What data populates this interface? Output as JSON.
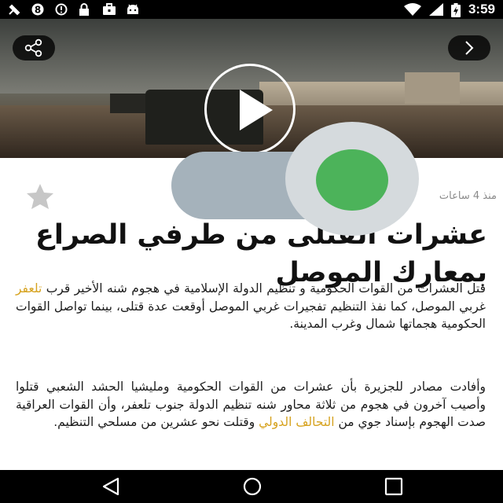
{
  "status_bar": {
    "time": "3:59",
    "icons": [
      "satellite-icon",
      "circle-8-icon",
      "block-icon",
      "lock-icon",
      "briefcase-icon",
      "android-icon",
      "wifi-icon",
      "signal-icon",
      "battery-charging-icon"
    ]
  },
  "hero": {
    "buttons": [
      "share-icon",
      "chevron-right-icon",
      "play-icon"
    ]
  },
  "article": {
    "timestamp": "منذ 4 ساعات",
    "title": "عشرات القتلى من طرفي الصراع بمعارك الموصل",
    "p1_part1": "قتل العشرات من القوات الحكومية و تنظيم الدولة الإسلامية في هجوم شنه الأخير قرب ",
    "p1_link": "تلعفر",
    "p1_part2": " غربي الموصل، كما نفذ التنظيم تفجيرات غربي الموصل أوقعت عدة قتلى، بينما تواصل القوات الحكومية هجماتها شمال وغرب المدينة.",
    "p2_part1": "وأفادت مصادر للجزيرة بأن عشرات من القوات الحكومية ومليشيا الحشد الشعبي قتلوا وأصيب آخرون في هجوم من ثلاثة محاور شنه تنظيم الدولة جنوب تلعفر، وأن القوات العراقية صدت الهجوم بإسناد جوي من ",
    "p2_link": "التحالف الدولي",
    "p2_part2": " وقتلت نحو عشرين من مسلحي التنظيم."
  },
  "toggle": {
    "state": "on",
    "knob_color": "#4cb35a",
    "track_color": "#a5b2bb"
  },
  "colors": {
    "link": "#d6a21e",
    "text": "#1c1c1c",
    "timestamp": "#8b8b8b"
  },
  "nav_bar": {
    "icons": [
      "back-icon",
      "home-icon",
      "recent-apps-icon"
    ]
  }
}
